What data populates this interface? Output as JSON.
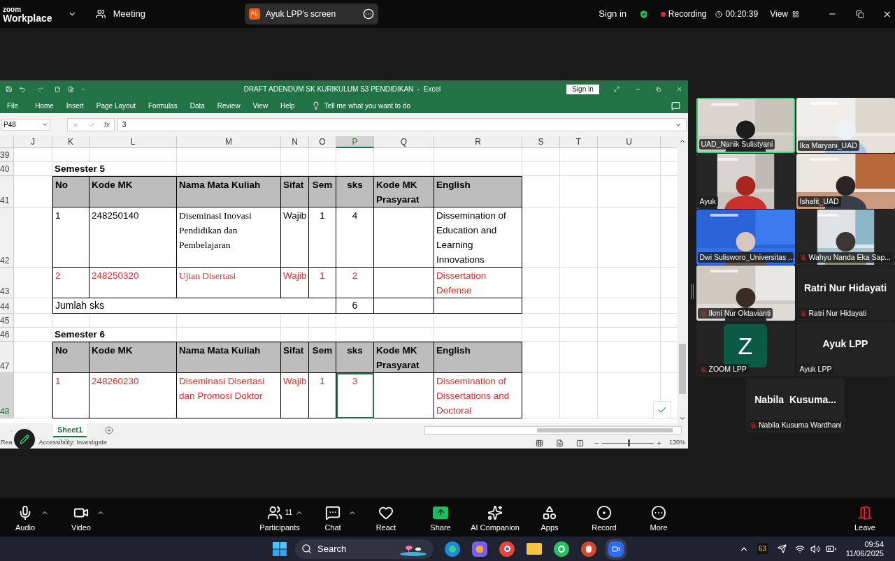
{
  "zoom_bar": {
    "logo_top": "zoom",
    "logo_bottom": "Workplace",
    "meeting": "Meeting",
    "share_pill": {
      "initials": "AL",
      "label": "Ayuk LPP's screen"
    },
    "sign_in": "Sign in",
    "recording": "Recording",
    "timer": "00:20:39",
    "view": "View"
  },
  "excel": {
    "title": "DRAFT ADENDUM SK KURIKULUM S3 PENDIDIKAN  -  Excel",
    "sign_in": "Sign in",
    "menu": [
      "File",
      "Home",
      "Insert",
      "Page Layout",
      "Formulas",
      "Data",
      "Review",
      "View",
      "Help"
    ],
    "tell_me": "Tell me what you want to do",
    "name_box": "P48",
    "function_label": "fx",
    "formula": "3",
    "columns": [
      {
        "label": "J",
        "selected": false
      },
      {
        "label": "K",
        "selected": false
      },
      {
        "label": "L",
        "selected": false
      },
      {
        "label": "M",
        "selected": false
      },
      {
        "label": "N",
        "selected": false
      },
      {
        "label": "O",
        "selected": false
      },
      {
        "label": "P",
        "selected": true
      },
      {
        "label": "Q",
        "selected": false
      },
      {
        "label": "R",
        "selected": false
      },
      {
        "label": "S",
        "selected": false
      },
      {
        "label": "T",
        "selected": false
      },
      {
        "label": "U",
        "selected": false
      }
    ],
    "rows": [
      {
        "number": "39",
        "selected": false,
        "kind": "blank"
      },
      {
        "number": "40",
        "selected": false,
        "kind": "title",
        "text": "Semester 5"
      },
      {
        "number": "41",
        "selected": false,
        "kind": "header",
        "cells": {
          "no": "No",
          "kode": "Kode MK",
          "nama": "Nama Mata Kuliah",
          "sifat": "Sifat",
          "sem": "Sem",
          "sks": "sks",
          "prasyarat": "Kode MK Prasyarat",
          "english": "English"
        }
      },
      {
        "number": "42",
        "selected": false,
        "kind": "course",
        "color": "#000000",
        "cells": {
          "no": "1",
          "kode": "248250140",
          "nama": "Diseminasi Inovasi Pendidikan dan Pembelajaran",
          "sifat": "Wajib",
          "sem": "1",
          "sks": "4",
          "english": "Dissemination of Education and Learning Innovations"
        }
      },
      {
        "number": "43",
        "selected": false,
        "kind": "course",
        "color": "#e02b2b",
        "cells": {
          "no": "2",
          "kode": "248250320",
          "nama": "Ujian Disertasi",
          "sifat": "Wajib",
          "sem": "1",
          "sks": "2",
          "english": "Dissertation Defense"
        }
      },
      {
        "number": "44",
        "selected": false,
        "kind": "total",
        "label": "Jumlah sks",
        "total": "6"
      },
      {
        "number": "45",
        "selected": false,
        "kind": "blank"
      },
      {
        "number": "46",
        "selected": false,
        "kind": "title",
        "text": "Semester 6"
      },
      {
        "number": "47",
        "selected": false,
        "kind": "header",
        "cells": {
          "no": "No",
          "kode": "Kode MK",
          "nama": "Nama Mata Kuliah",
          "sifat": "Sifat",
          "sem": "Sem",
          "sks": "sks",
          "prasyarat": "Kode MK Prasyarat",
          "english": "English"
        }
      },
      {
        "number": "48",
        "selected": true,
        "kind": "course",
        "color": "#e02b2b",
        "cells": {
          "no": "1",
          "kode": "248260230",
          "nama": "Diseminasi Disertasi dan Promosi Doktor",
          "sifat": "Wajib",
          "sem": "1",
          "sks": "3",
          "english": "Dissemination of Dissertations and Doctoral"
        }
      }
    ],
    "sheet_tabs": [
      {
        "label": "Sheet1",
        "selected": true
      }
    ],
    "status": "Rea",
    "accessibility": "Accessibility: Investigate",
    "zoom_slider": {
      "level": 0.52
    },
    "zoom": "130%"
  },
  "gallery": [
    {
      "name": "UAD_Nanik Sulistyani",
      "kind": "video",
      "muted": false,
      "active_speaker": true
    },
    {
      "name": "Ika Maryani_UAD",
      "kind": "video",
      "muted": false,
      "active_speaker": false
    },
    {
      "name": "Ayuk",
      "kind": "video",
      "muted": false,
      "active_speaker": false
    },
    {
      "name": "Ishafit_UAD",
      "kind": "video",
      "muted": false,
      "active_speaker": false
    },
    {
      "name": "Dwi Sulisworo_Universitas ...",
      "kind": "video",
      "muted": false,
      "active_speaker": false
    },
    {
      "name": "Wahyu Nanda Eka Sap...",
      "kind": "video",
      "muted": true,
      "active_speaker": false
    },
    {
      "name": "Ikmi Nur Oktavianti",
      "kind": "video",
      "muted": true,
      "active_speaker": false
    },
    {
      "name": "Ratri Nur Hidayati",
      "kind": "name",
      "display": "Ratri Nur Hidayati",
      "muted": true,
      "active_speaker": false
    },
    {
      "name": "ZOOM LPP",
      "kind": "avatar",
      "initial": "Z",
      "muted": true,
      "active_speaker": false
    },
    {
      "name": "Ayuk LPP",
      "kind": "name",
      "display": "Ayuk LPP",
      "muted": false,
      "active_speaker": false
    },
    {
      "name": "Nabila Kusuma Wardhani",
      "kind": "name",
      "display": "Nabila  Kusuma...",
      "muted": true,
      "active_speaker": false
    }
  ],
  "toolbar": [
    {
      "kind": "audio",
      "label": "Audio",
      "caret": true
    },
    {
      "kind": "video",
      "label": "Video",
      "caret": true
    },
    {
      "kind": "participants",
      "label": "Participants",
      "badge": "11",
      "caret": true
    },
    {
      "kind": "chat",
      "label": "Chat",
      "caret": true
    },
    {
      "kind": "react",
      "label": "React",
      "caret": false
    },
    {
      "kind": "share",
      "label": "Share",
      "caret": false
    },
    {
      "kind": "ai",
      "label": "AI Companion",
      "caret": false
    },
    {
      "kind": "apps",
      "label": "Apps",
      "caret": false
    },
    {
      "kind": "record",
      "label": "Record",
      "caret": false
    },
    {
      "kind": "more",
      "label": "More",
      "caret": false
    },
    {
      "kind": "leave",
      "label": "Leave",
      "caret": false
    }
  ],
  "taskbar": {
    "search": "Search",
    "tray_badge": "63",
    "time": "09:54",
    "date": "11/06/2025"
  }
}
